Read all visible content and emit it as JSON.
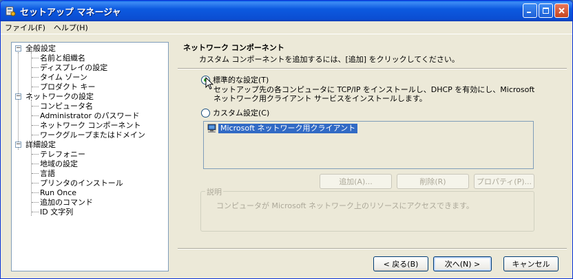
{
  "window": {
    "title": "セットアップ マネージャ"
  },
  "menu": [
    "ファイル(F)",
    "ヘルプ(H)"
  ],
  "tree": {
    "groups": [
      {
        "label": "全般設定",
        "children": [
          "名前と組織名",
          "ディスプレイの設定",
          "タイム ゾーン",
          "プロダクト キー"
        ]
      },
      {
        "label": "ネットワークの設定",
        "children": [
          "コンピュータ名",
          "Administrator のパスワード",
          "ネットワーク コンポーネント",
          "ワークグループまたはドメイン"
        ]
      },
      {
        "label": "詳細設定",
        "children": [
          "テレフォニー",
          "地域の設定",
          "言語",
          "プリンタのインストール",
          "Run Once",
          "追加のコマンド",
          "ID 文字列"
        ]
      }
    ],
    "expand_glyph": "−"
  },
  "header": {
    "title": "ネットワーク コンポーネント",
    "subtitle": "カスタム コンポーネントを追加するには、[追加] をクリックしてください。"
  },
  "options": {
    "typical_label": "標準的な設定(T)",
    "typical_desc": "セットアップ先の各コンピュータに TCP/IP をインストールし、DHCP を有効にし、Microsoft ネットワーク用クライアント サービスをインストールします。",
    "custom_label": "カスタム設定(C)",
    "selected": "typical"
  },
  "components": [
    "Microsoft ネットワーク用クライアント"
  ],
  "buttons": {
    "add": "追加(A)...",
    "remove": "削除(R)",
    "properties": "プロパティ(P)...",
    "back": "< 戻る(B)",
    "next": "次へ(N) >",
    "cancel": "キャンセル"
  },
  "description": {
    "legend": "説明",
    "text": "コンピュータが Microsoft ネットワーク上のリソースにアクセスできます。"
  },
  "colors": {
    "titlebar": "#0b4ed2",
    "selection": "#316ac5",
    "face": "#ece9d8"
  }
}
